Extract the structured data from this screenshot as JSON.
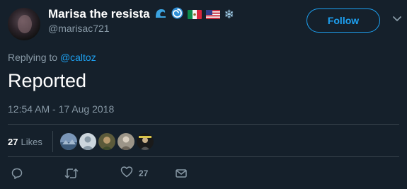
{
  "tweet": {
    "display_name": "Marisa the resista",
    "username": "@marisac721",
    "follow_label": "Follow",
    "replying_prefix": "Replying to",
    "replying_to": "@caltoz",
    "text": "Reported",
    "timestamp": "12:54 AM - 17 Aug 2018",
    "likes_count": "27",
    "likes_label": "Likes",
    "like_action_count": "27"
  },
  "emojis": [
    "wave-emoji",
    "cyclone-emoji",
    "mexico-flag",
    "usa-flag",
    "snowflake-emoji"
  ],
  "colors": {
    "background": "#15202b",
    "accent": "#1da1f2",
    "secondary_text": "#8899a6",
    "divider": "#38444d"
  }
}
